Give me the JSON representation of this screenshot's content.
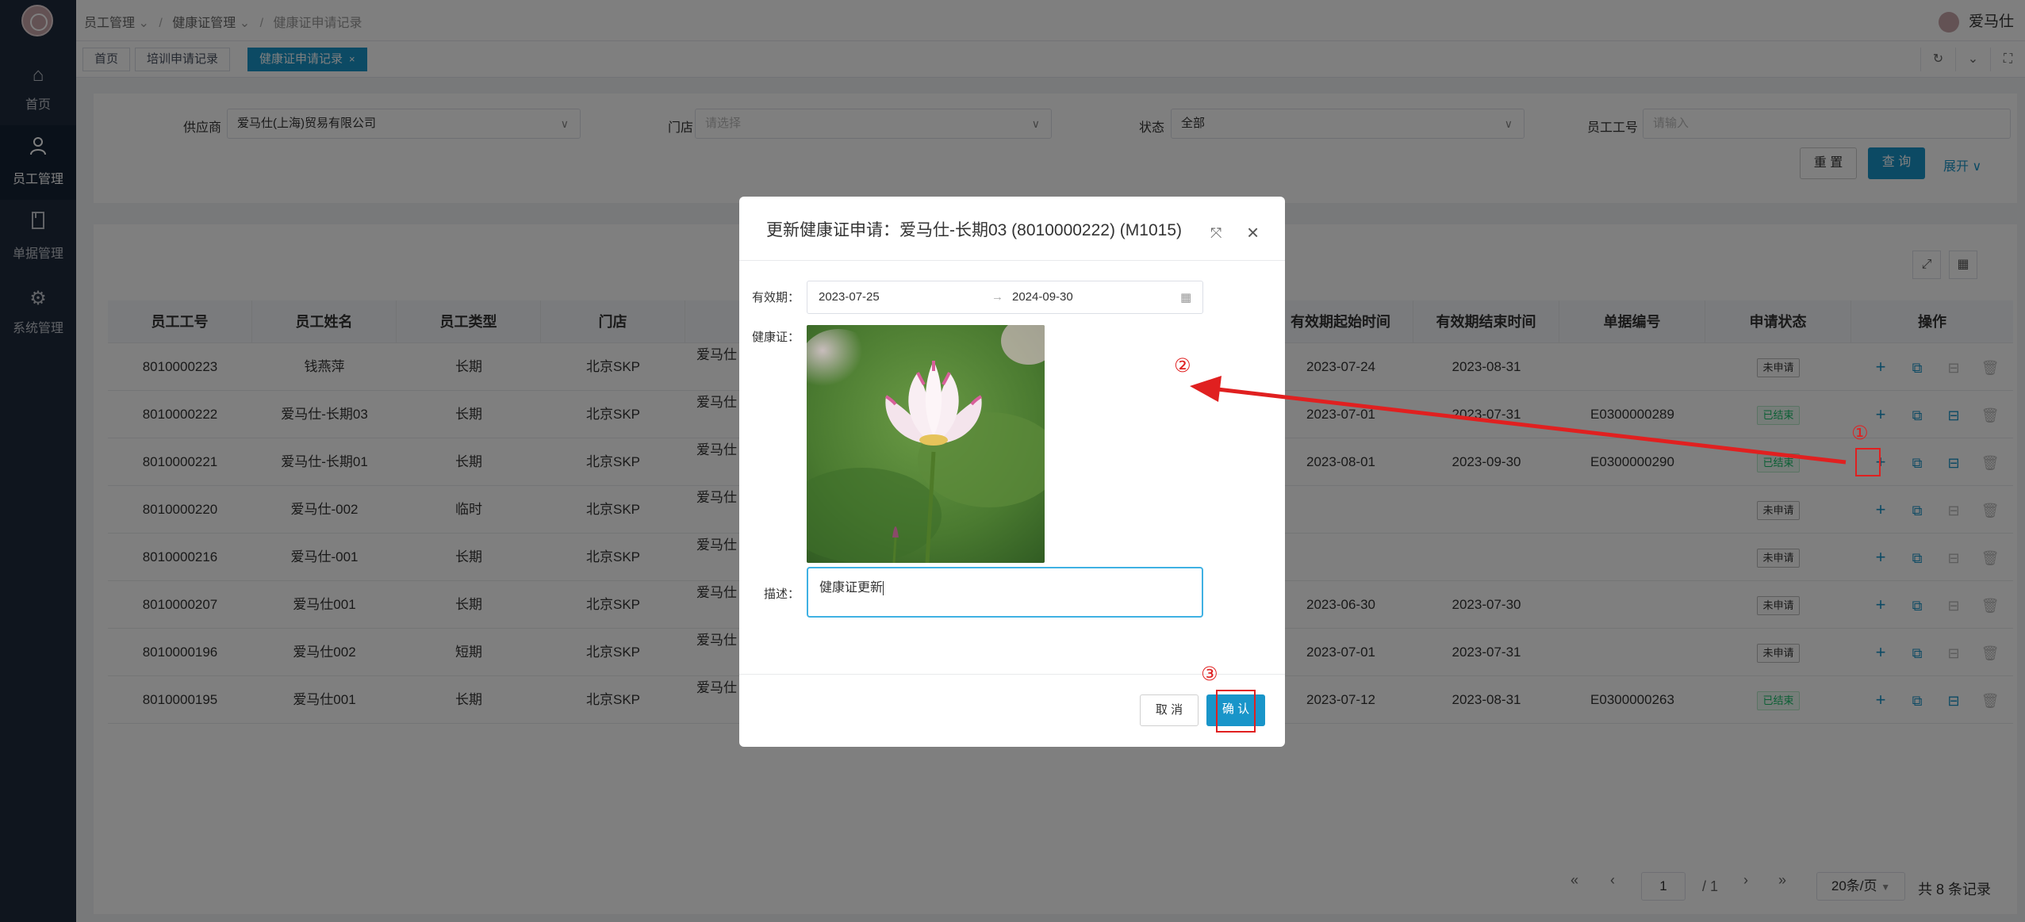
{
  "sidebar": {
    "items": [
      {
        "label": "首页",
        "icon": "home-icon"
      },
      {
        "label": "员工管理",
        "icon": "user-icon"
      },
      {
        "label": "单据管理",
        "icon": "document-icon"
      },
      {
        "label": "系统管理",
        "icon": "gear-icon"
      }
    ]
  },
  "breadcrumb": [
    "员工管理",
    "健康证管理",
    "健康证申请记录"
  ],
  "user_name": "爱马仕",
  "tabs": [
    {
      "label": "首页"
    },
    {
      "label": "培训申请记录"
    },
    {
      "label": "健康证申请记录",
      "close": "×"
    }
  ],
  "filter": {
    "supplier_label": "供应商",
    "supplier_value": "爱马仕(上海)贸易有限公司",
    "store_label": "门店",
    "store_placeholder": "请选择",
    "status_label": "状态",
    "status_value": "全部",
    "empno_label": "员工工号",
    "empno_placeholder": "请输入",
    "reset": "重 置",
    "query": "查 询",
    "expand": "展开"
  },
  "table": {
    "headers": [
      "员工工号",
      "员工姓名",
      "员工类型",
      "门店",
      "有效期起始时间",
      "有效期结束时间",
      "单据编号",
      "申请状态",
      "操作"
    ],
    "rows": [
      {
        "no": "8010000223",
        "name": "钱燕萍",
        "type": "长期",
        "store": "北京SKP",
        "supplier": "爱马仕",
        "start": "2023-07-24",
        "end": "2023-08-31",
        "doc": "",
        "status": "未申请",
        "done": false
      },
      {
        "no": "8010000222",
        "name": "爱马仕-长期03",
        "type": "长期",
        "store": "北京SKP",
        "supplier": "爱马仕",
        "start": "2023-07-01",
        "end": "2023-07-31",
        "doc": "E0300000289",
        "status": "已结束",
        "done": true
      },
      {
        "no": "8010000221",
        "name": "爱马仕-长期01",
        "type": "长期",
        "store": "北京SKP",
        "supplier": "爱马仕",
        "start": "2023-08-01",
        "end": "2023-09-30",
        "doc": "E0300000290",
        "status": "已结束",
        "done": true
      },
      {
        "no": "8010000220",
        "name": "爱马仕-002",
        "type": "临时",
        "store": "北京SKP",
        "supplier": "爱马仕",
        "start": "",
        "end": "",
        "doc": "",
        "status": "未申请",
        "done": false
      },
      {
        "no": "8010000216",
        "name": "爱马仕-001",
        "type": "长期",
        "store": "北京SKP",
        "supplier": "爱马仕",
        "start": "",
        "end": "",
        "doc": "",
        "status": "未申请",
        "done": false
      },
      {
        "no": "8010000207",
        "name": "爱马仕001",
        "type": "长期",
        "store": "北京SKP",
        "supplier": "爱马仕",
        "start": "2023-06-30",
        "end": "2023-07-30",
        "doc": "",
        "status": "未申请",
        "done": false
      },
      {
        "no": "8010000196",
        "name": "爱马仕002",
        "type": "短期",
        "store": "北京SKP",
        "supplier": "爱马仕",
        "start": "2023-07-01",
        "end": "2023-07-31",
        "doc": "",
        "status": "未申请",
        "done": false
      },
      {
        "no": "8010000195",
        "name": "爱马仕001",
        "type": "长期",
        "store": "北京SKP",
        "supplier": "爱马仕",
        "start": "2023-07-12",
        "end": "2023-08-31",
        "doc": "E0300000263",
        "status": "已结束",
        "done": true
      }
    ]
  },
  "pager": {
    "page": "1",
    "total_pages": "/ 1",
    "page_size": "20条/页",
    "total": "共 8 条记录"
  },
  "modal": {
    "title": "更新健康证申请：爱马仕-长期03 (8010000222) (M1015)",
    "validity_label": "有效期：",
    "date_start": "2023-07-25",
    "date_end": "2024-09-30",
    "cert_label": "健康证：",
    "desc_label": "描述：",
    "desc_value": "健康证更新",
    "cancel": "取 消",
    "confirm": "确 认"
  },
  "annotations": {
    "step1": "①",
    "step2": "②",
    "step3": "③"
  },
  "colors": {
    "primary": "#1995c9",
    "sidebar": "#1f2a3c",
    "annotation": "#e02020",
    "success": "#19be6b"
  }
}
